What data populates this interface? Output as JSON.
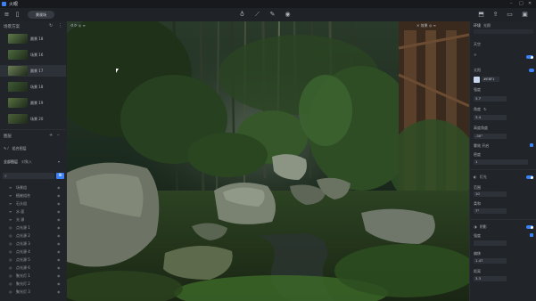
{
  "titlebar": {
    "title": "火眼"
  },
  "toolbar": {
    "scene_label": "景观场"
  },
  "left": {
    "section_title": "场景方案",
    "thumbnails": [
      {
        "label": "晨景 18",
        "selected": false
      },
      {
        "label": "场景 16",
        "selected": false
      },
      {
        "label": "晨景 17",
        "selected": true
      },
      {
        "label": "场景 18",
        "selected": false
      },
      {
        "label": "晨景 19",
        "selected": false
      },
      {
        "label": "场景 20",
        "selected": false
      }
    ],
    "layers_title": "图层",
    "group_label": "组合图层",
    "tabs": [
      "全部图层",
      "对象入"
    ],
    "layers": [
      {
        "icon": "≡",
        "label": "场景组"
      },
      {
        "icon": "≡",
        "label": "植被组合"
      },
      {
        "icon": "≡",
        "label": "石头组"
      },
      {
        "icon": "≡",
        "label": "水 面"
      },
      {
        "icon": "≡",
        "label": "光 源"
      },
      {
        "icon": "◎",
        "label": "点光源 1"
      },
      {
        "icon": "◎",
        "label": "点光源 2"
      },
      {
        "icon": "◎",
        "label": "点光源 3"
      },
      {
        "icon": "◎",
        "label": "点光源 4"
      },
      {
        "icon": "◎",
        "label": "点光源 5"
      },
      {
        "icon": "◎",
        "label": "点光源 6"
      },
      {
        "icon": "◎",
        "label": "聚光灯 1"
      },
      {
        "icon": "◎",
        "label": "聚光灯 2"
      },
      {
        "icon": "◎",
        "label": "聚光灯 3"
      }
    ]
  },
  "viewport": {
    "left_hint": "ᐊ ᐅ  ◎ ≡",
    "right_hint": "✕  效果  ◎  ≡"
  },
  "right": {
    "tabs": [
      "环境",
      "光照"
    ],
    "section_env": "天空",
    "sun_label": "太阳",
    "color_value": "#E8F1",
    "intensity_label": "强度",
    "intensity_value": "3.7",
    "angle_label": "角度",
    "angle_value": "3.4",
    "height_label": "高度角度",
    "height_value": "-30°",
    "fog_label": "雾效 开启",
    "density_label": "密度",
    "density_value": "1",
    "light_label": "灯光",
    "light_range_label": "范围",
    "light_range_value": "10",
    "light_soft_label": "柔和",
    "light_soft_value": "7°",
    "shadow_label": "阴影",
    "shadow_sub_label": "强度",
    "shadow_sub_value": "",
    "bias_label": "偏移",
    "bias_value": "1.47",
    "extra_label": "距离",
    "extra_value": "3.3"
  }
}
